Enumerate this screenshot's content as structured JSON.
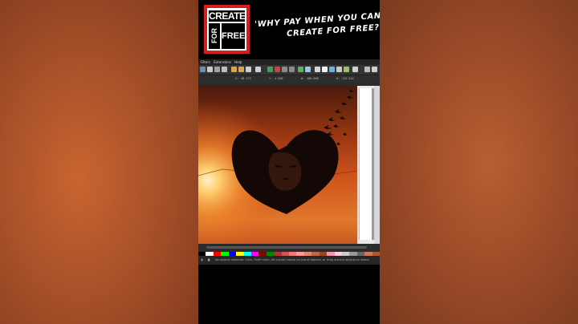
{
  "banner": {
    "logo_create": "CREATE",
    "logo_for": "FOR",
    "logo_free": "FREE",
    "tagline_line1": "'WHY PAY WHEN YOU CAN",
    "tagline_line2": "CREATE FOR FREE?'"
  },
  "menubar": {
    "items": [
      "Filters",
      "Extensions",
      "Help"
    ]
  },
  "controls": {
    "x_label": "X:",
    "x_value": "48.173",
    "y_label": "Y:",
    "y_value": "4.036",
    "w_label": "W:",
    "w_value": "160.000",
    "h_label": "H:",
    "h_value": "119.542"
  },
  "statusbar": {
    "message": "No objects selected. Click, Shift+click, Alt+scroll mouse on top of objects, or drag around objects to select."
  },
  "colors": {
    "sky_top": "#5a2010",
    "sky_mid": "#c8501c",
    "sun": "#ffd27a",
    "silhouette": "#120806",
    "logo_red": "#d41f1f"
  },
  "icons": [
    "document-icon",
    "open-icon",
    "save-icon",
    "print-icon",
    "import-icon",
    "export-icon",
    "undo-icon",
    "redo-icon",
    "cut-icon",
    "copy-icon",
    "paste-icon",
    "zoom-in-icon",
    "zoom-out-icon",
    "zoom-fit-icon",
    "group-icon",
    "ungroup-icon",
    "node-icon",
    "text-icon",
    "xml-icon",
    "fill-stroke-icon",
    "align-icon",
    "preferences-icon"
  ]
}
